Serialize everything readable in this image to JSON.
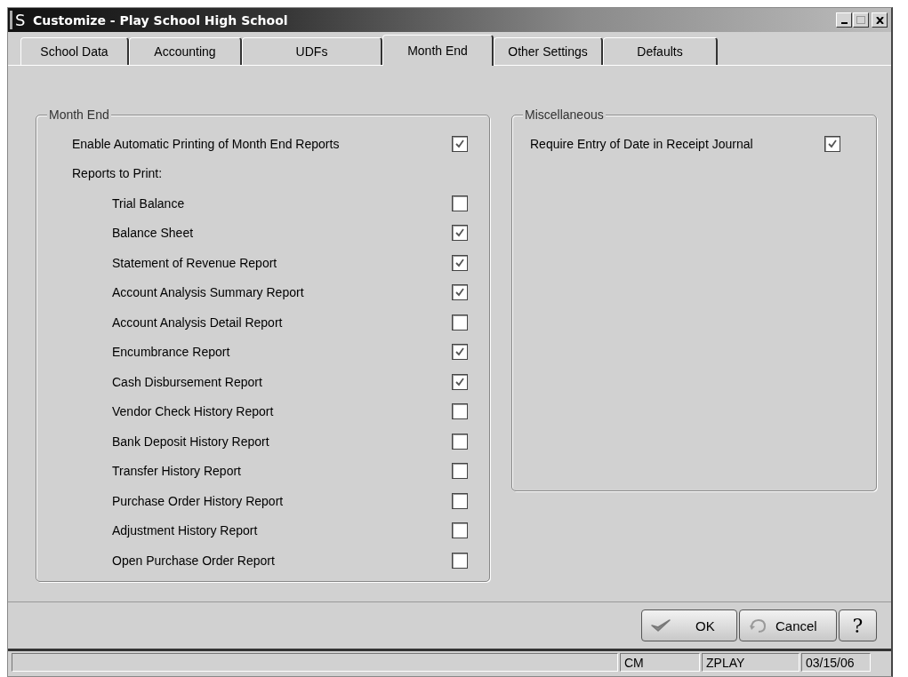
{
  "window": {
    "title": "Customize - Play School High School",
    "app_letter": "S"
  },
  "tabs": [
    {
      "label": "School Data",
      "selected": false
    },
    {
      "label": "Accounting",
      "selected": false
    },
    {
      "label": "UDFs",
      "selected": false
    },
    {
      "label": "Month End",
      "selected": true
    },
    {
      "label": "Other Settings",
      "selected": false
    },
    {
      "label": "Defaults",
      "selected": false
    }
  ],
  "month_end": {
    "title": "Month End",
    "enable": {
      "label": "Enable Automatic Printing of Month End Reports",
      "checked": true
    },
    "reports_label": "Reports to Print:",
    "reports": [
      {
        "label": "Trial Balance",
        "checked": false
      },
      {
        "label": "Balance Sheet",
        "checked": true
      },
      {
        "label": "Statement of Revenue Report",
        "checked": true
      },
      {
        "label": "Account Analysis Summary Report",
        "checked": true
      },
      {
        "label": "Account Analysis Detail Report",
        "checked": false
      },
      {
        "label": "Encumbrance Report",
        "checked": true
      },
      {
        "label": "Cash Disbursement Report",
        "checked": true
      },
      {
        "label": "Vendor Check History Report",
        "checked": false
      },
      {
        "label": "Bank Deposit History Report",
        "checked": false
      },
      {
        "label": "Transfer History Report",
        "checked": false
      },
      {
        "label": "Purchase Order History Report",
        "checked": false
      },
      {
        "label": "Adjustment History Report",
        "checked": false
      },
      {
        "label": "Open Purchase Order Report",
        "checked": false
      }
    ]
  },
  "miscellaneous": {
    "title": "Miscellaneous",
    "options": [
      {
        "label": "Require Entry of Date in Receipt Journal",
        "checked": true
      }
    ]
  },
  "buttons": [
    {
      "kind": "ok",
      "label": "OK"
    },
    {
      "kind": "cancel",
      "label": "Cancel"
    },
    {
      "kind": "help",
      "label": "?"
    }
  ],
  "status_bar": [
    "CM",
    "ZPLAY",
    "03/15/06"
  ]
}
